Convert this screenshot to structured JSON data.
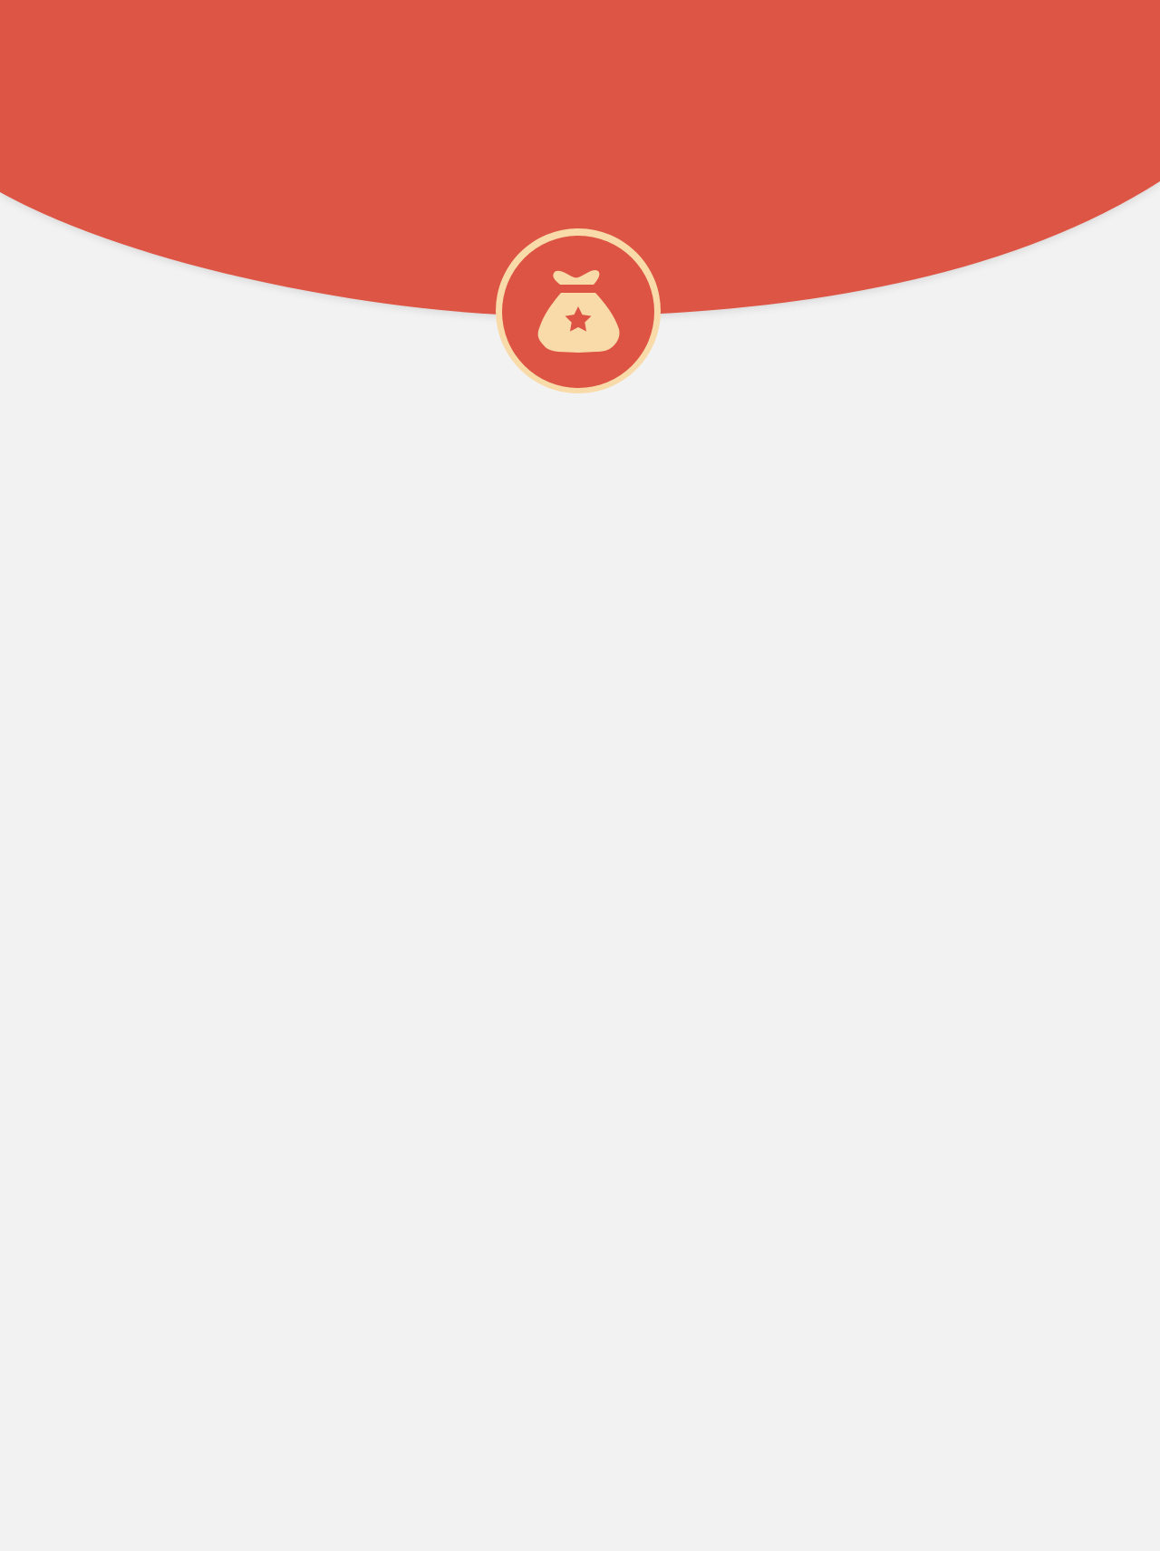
{
  "theme": {
    "background": "#f2f2f2",
    "header_red": "#dd5444",
    "badge_cream": "#f9dbaa"
  },
  "header": {
    "badge": {
      "icon": "money-bag-star-icon"
    }
  }
}
